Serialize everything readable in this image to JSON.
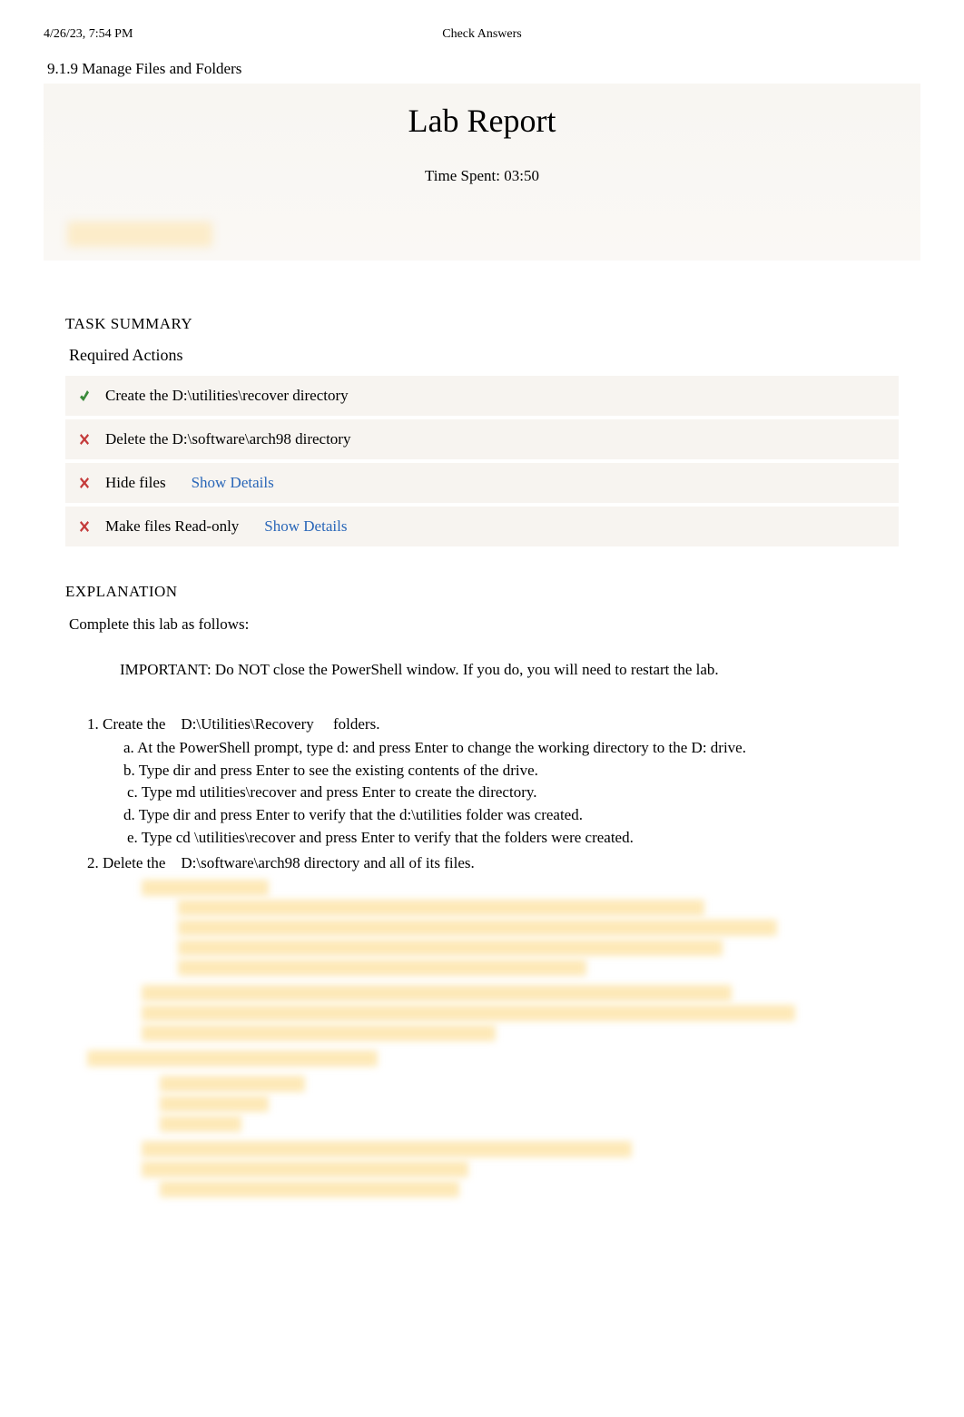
{
  "header": {
    "timestamp": "4/26/23, 7:54 PM",
    "center": "Check Answers"
  },
  "section_title": "9.1.9 Manage Files and Folders",
  "report": {
    "title": "Lab Report",
    "time_spent": "Time Spent: 03:50"
  },
  "tasks": {
    "heading": "TASK SUMMARY",
    "required_heading": "Required Actions",
    "show_details_label": "Show Details",
    "items": [
      {
        "status": "pass",
        "text": "Create the D:\\utilities\\recover directory",
        "details": false
      },
      {
        "status": "fail",
        "text": "Delete the D:\\software\\arch98 directory",
        "details": false
      },
      {
        "status": "fail",
        "text": "Hide files",
        "details": true
      },
      {
        "status": "fail",
        "text": "Make files Read-only",
        "details": true
      }
    ]
  },
  "explanation": {
    "heading": "EXPLANATION",
    "intro": "Complete this lab as follows:",
    "important": "IMPORTANT: Do NOT close the PowerShell window. If you do, you will need to restart the lab.",
    "steps": {
      "s1": {
        "num": "1.",
        "pre": "Create the ",
        "path": "D:\\Utilities\\Recovery",
        "post": " folders."
      },
      "s1a": "a. At the PowerShell prompt, type       d:  and press   Enter  to change the working directory to the D: drive.",
      "s1b": "b. Type  dir  and press   Enter  to see the existing contents of the drive.",
      "s1c": "c. Type  md utilities\\recover      and press   Enter  to create the directory.",
      "s1d": "d. Type  dir  and press   Enter  to verify that the d:\\utilities folder was created.",
      "s1e": "e. Type  cd \\utilities\\recover      and press   Enter  to verify that the folders were created.",
      "s2": {
        "num": "2.",
        "pre": "Delete the ",
        "path": "D:\\software\\arch98",
        "post": "    directory and all of its files."
      }
    }
  }
}
